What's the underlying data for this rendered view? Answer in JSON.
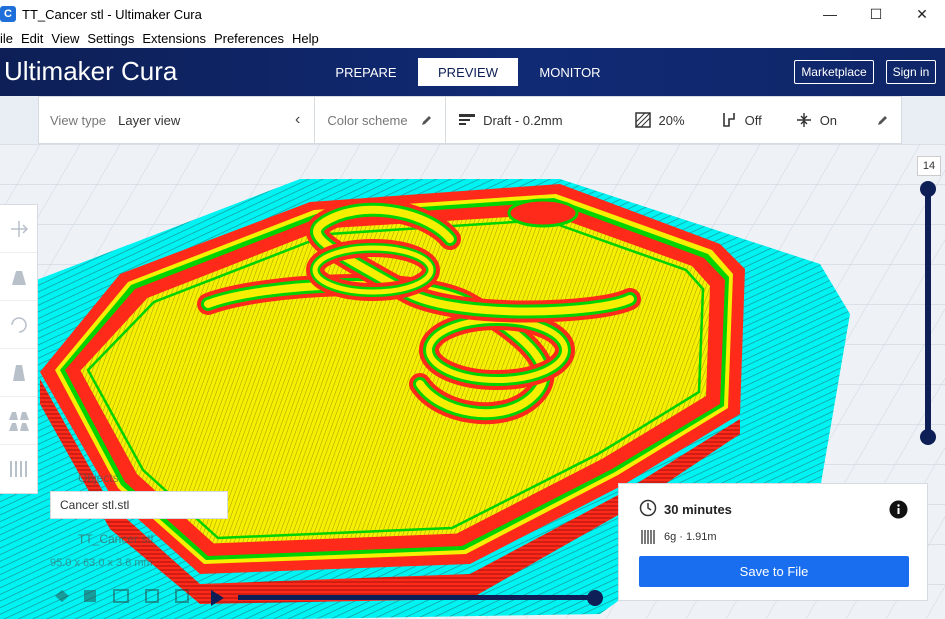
{
  "window": {
    "title": "TT_Cancer stl - Ultimaker Cura",
    "minimize_glyph": "—",
    "maximize_glyph": "☐",
    "close_glyph": "✕",
    "app_icon_letter": "C"
  },
  "menu": [
    "ile",
    "Edit",
    "View",
    "Settings",
    "Extensions",
    "Preferences",
    "Help"
  ],
  "header": {
    "logo_bold": "Ultimaker",
    "logo_light": "Cura",
    "tabs": [
      "PREPARE",
      "PREVIEW",
      "MONITOR"
    ],
    "active_tab": "PREVIEW",
    "marketplace": "Marketplace",
    "signin": "Sign in"
  },
  "toolbar": {
    "view_type_label": "View type",
    "view_type_value": "Layer view",
    "color_scheme_label": "Color scheme",
    "profile": "Draft - 0.2mm",
    "infill": "20%",
    "support": "Off",
    "adhesion": "On"
  },
  "objects": {
    "label": "Objects",
    "input_value": "Cancer stl.stl",
    "item_name": "TT_Cancer stl",
    "dimensions": "95.0 x 63.0 x 3.8 mm"
  },
  "print_info": {
    "time": "30 minutes",
    "material": "6g · 1.91m",
    "save_label": "Save to File"
  },
  "layer_slider": {
    "current_layer": "14",
    "upper_fraction": 1.0,
    "lower_fraction": 0.0
  },
  "colors": {
    "header": "#0d1f56",
    "accent": "#196ef0",
    "shell": "#ff2a1a",
    "infill": "#f6ef00",
    "inner_wall": "#00d300",
    "skirt": "#00f3f3"
  }
}
